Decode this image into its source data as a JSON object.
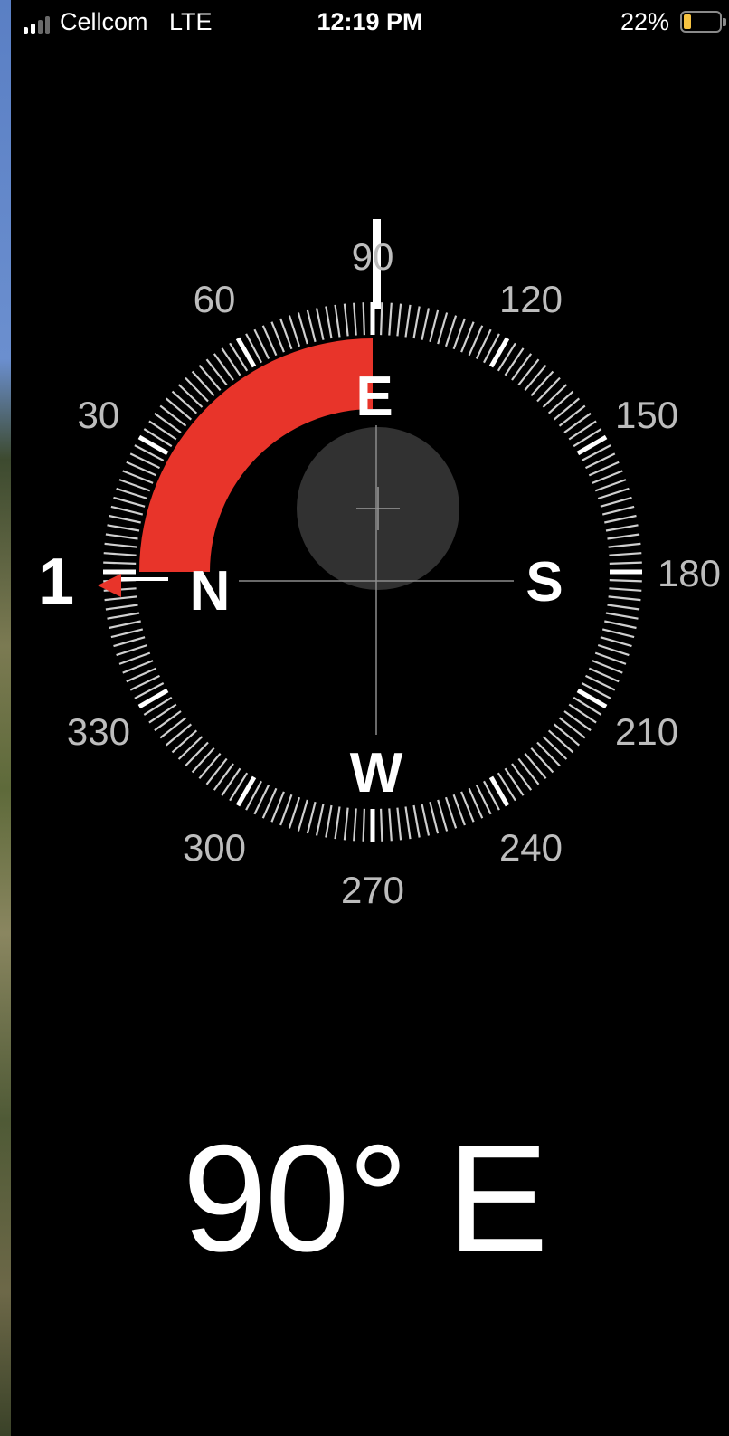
{
  "status_bar": {
    "carrier": "Cellcom",
    "network": "LTE",
    "time": "12:19 PM",
    "battery_percent": "22%",
    "battery_level": 0.22,
    "signal_bars_active": 2,
    "signal_bars_total": 4
  },
  "compass": {
    "heading_degrees": 90,
    "cardinals": {
      "N": "N",
      "E": "E",
      "S": "S",
      "W": "W"
    },
    "degree_labels": [
      "30",
      "60",
      "90",
      "120",
      "150",
      "180",
      "210",
      "240",
      "270",
      "300",
      "330"
    ],
    "target_marker_label": "1",
    "colors": {
      "accent": "#e8342a",
      "ticks": "#cfcfcf",
      "background": "#000000"
    },
    "icons": [
      "level-bubble-icon",
      "crosshair-icon",
      "target-arrow-icon"
    ]
  },
  "heading_readout": "90° E"
}
